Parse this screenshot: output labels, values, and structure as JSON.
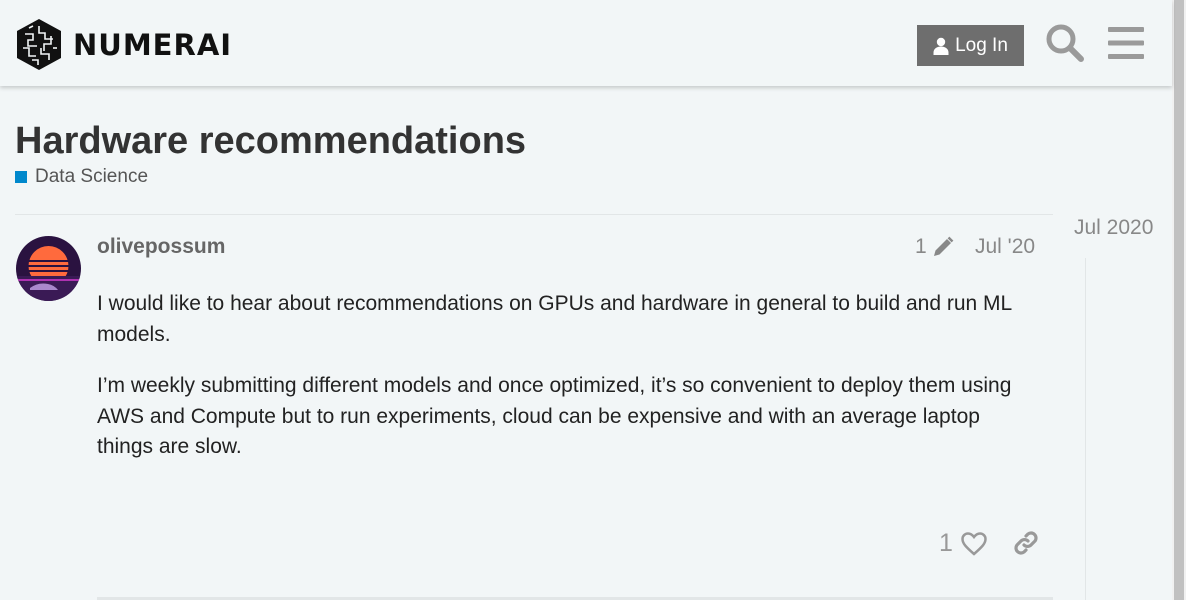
{
  "header": {
    "logo_text": "NUMERAI",
    "login_label": "Log In",
    "icons": {
      "login": "user-icon",
      "search": "search-icon",
      "menu": "hamburger-menu-icon"
    }
  },
  "topic": {
    "title": "Hardware recommendations",
    "category": {
      "label": "Data Science",
      "color": "#0088cc"
    }
  },
  "post": {
    "username": "olivepossum",
    "edit_count": "1",
    "date": "Jul '20",
    "paragraphs": [
      "I would like to hear about recommendations on GPUs and hardware in general to build and run ML models.",
      "I’m weekly submitting different models and once optimized, it’s so convenient to deploy them using AWS and Compute but to run experiments, cloud can be expensive and with an average laptop things are slow."
    ],
    "like_count": "1"
  },
  "timeline": {
    "date": "Jul 2020"
  }
}
